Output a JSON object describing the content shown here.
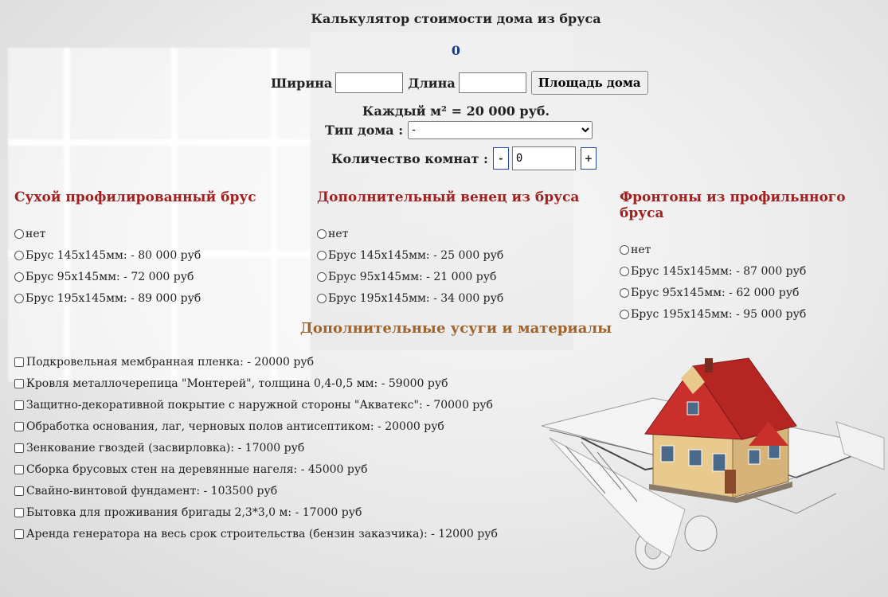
{
  "title": "Калькулятор стоимости дома из бруса",
  "total": "0",
  "area": {
    "width_label": "Ширина",
    "width_value": "",
    "length_label": "Длина",
    "length_value": "",
    "button_label": "Площадь дома"
  },
  "price_per_m2": "Каждый м² = 20 000 руб.",
  "house_type": {
    "label": "Тип дома :",
    "selected": "-"
  },
  "rooms": {
    "label": "Количество комнат :",
    "minus": "-",
    "plus": "+",
    "value": "0"
  },
  "columns": [
    {
      "title": "Сухой профилированный брус",
      "options": [
        "нет",
        "Брус 145х145мм: - 80 000 руб",
        "Брус 95х145мм: - 72 000 руб",
        "Брус 195х145мм: - 89 000 руб"
      ]
    },
    {
      "title": "Дополнительный венец из бруса",
      "options": [
        "нет",
        "Брус 145х145мм: - 25 000 руб",
        "Брус 95х145мм: - 21 000 руб",
        "Брус 195х145мм: - 34 000 руб"
      ]
    },
    {
      "title": "Фронтоны из профильнного бруса",
      "options": [
        "нет",
        "Брус 145х145мм: - 87 000 руб",
        "Брус 95х145мм: - 62 000 руб",
        "Брус 195х145мм: - 95 000 руб"
      ]
    }
  ],
  "extras": {
    "title": "Дополнительные усуги и материалы",
    "items": [
      "Подкровельная мембранная пленка: - 20000 руб",
      "Кровля металлочерепица \"Монтерей\", толщина 0,4-0,5 мм: - 59000 руб",
      "Защитно-декоративной покрытие с наружной стороны \"Акватекс\": - 70000 руб",
      "Обработка основания, лаг, черновых полов антисептиком: - 20000 руб",
      "Зенкование гвоздей (засвирловка): - 17000 руб",
      "Сборка брусовых стен на деревянные нагеля: - 45000 руб",
      "Свайно-винтовой фундамент: - 103500 руб",
      "Бытовка для проживания бригады 2,3*3,0 м: - 17000 руб",
      "Аренда генератора на весь срок строительства (бензин заказчика): - 12000 руб"
    ]
  },
  "colors": {
    "section_title": "#a02020",
    "extras_title": "#a0642d",
    "total": "#1a3a8a",
    "roof": "#c9302c",
    "walls": "#e8c98e"
  }
}
